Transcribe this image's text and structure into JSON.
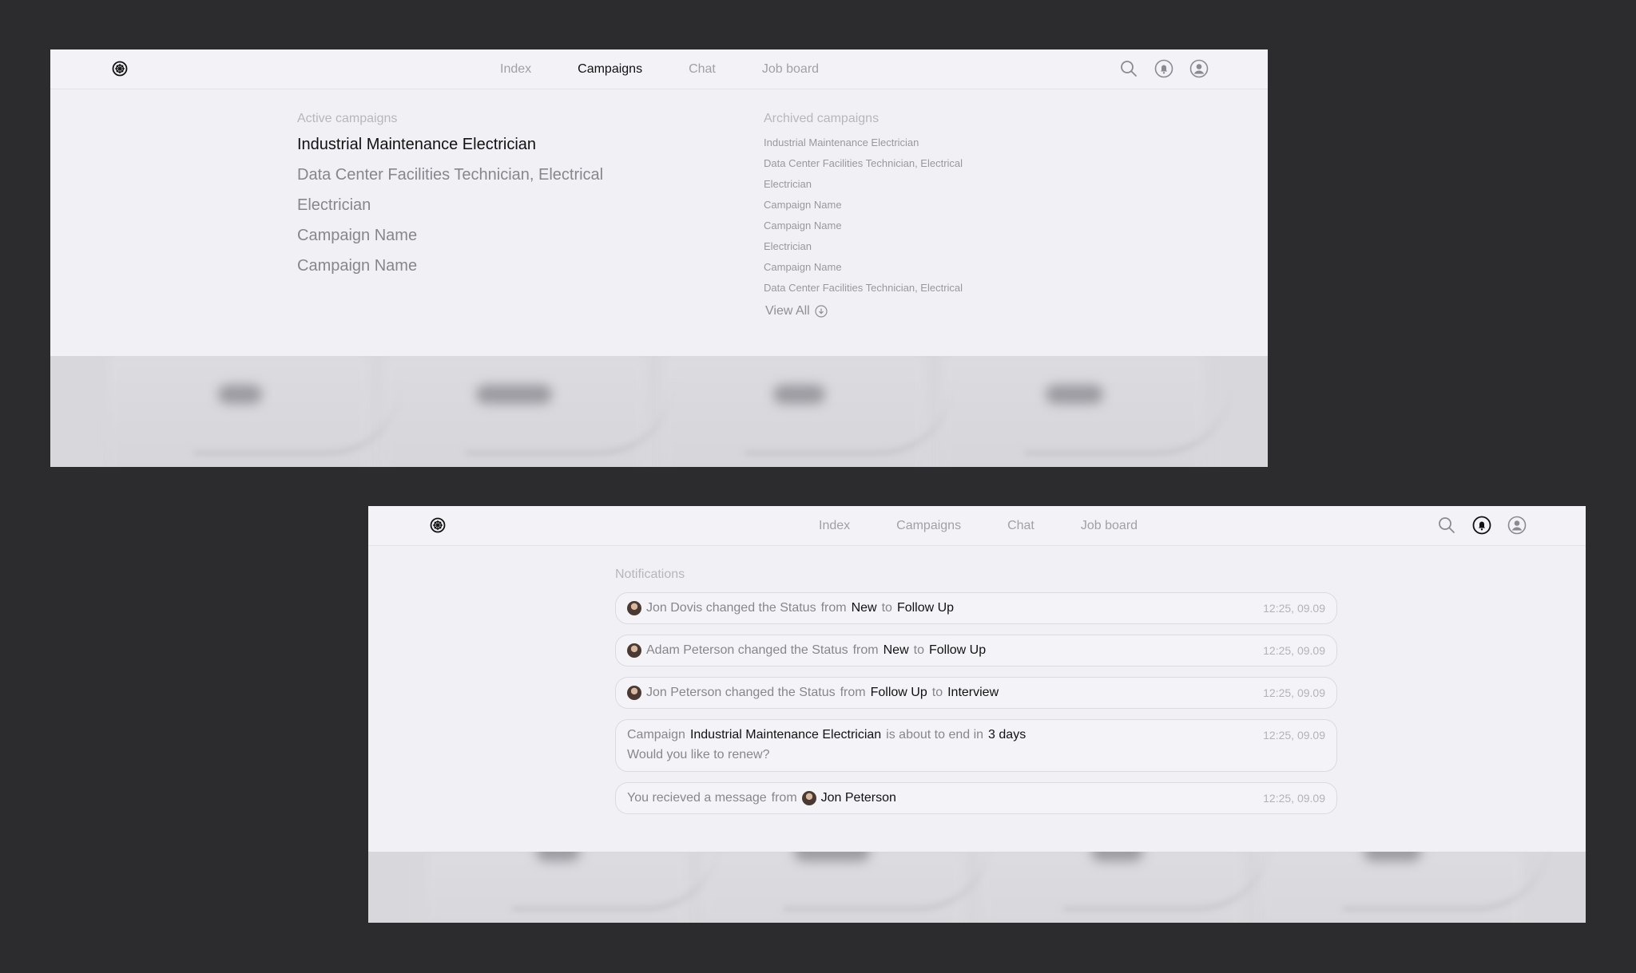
{
  "nav": {
    "items": [
      "Index",
      "Campaigns",
      "Chat",
      "Job board"
    ]
  },
  "panel1": {
    "active_nav": "Campaigns",
    "active_title": "Active campaigns",
    "active": [
      "Industrial Maintenance Electrician",
      "Data Center Facilities Technician, Electrical",
      "Electrician",
      "Campaign Name",
      "Campaign Name"
    ],
    "archived_title": "Archived campaigns",
    "archived": [
      "Industrial Maintenance Electrician",
      "Data Center Facilities Technician, Electrical",
      "Electrician",
      "Campaign Name",
      "Campaign Name",
      "Electrician",
      "Campaign Name",
      "Data Center Facilities Technician, Electrical"
    ],
    "view_all": "View All"
  },
  "panel2": {
    "title": "Notifications",
    "n1": {
      "who": "Jon Dovis changed the Status",
      "from": "from",
      "old": "New",
      "to": "to",
      "new": "Follow Up",
      "time": "12:25, 09.09"
    },
    "n2": {
      "who": "Adam Peterson changed the Status",
      "from": "from",
      "old": "New",
      "to": "to",
      "new": "Follow Up",
      "time": "12:25, 09.09"
    },
    "n3": {
      "who": "Jon Peterson changed the Status",
      "from": "from",
      "old": "Follow Up",
      "to": "to",
      "new": "Interview",
      "time": "12:25, 09.09"
    },
    "n4": {
      "pre": "Campaign",
      "campaign": "Industrial Maintenance Electrician",
      "mid": "is about to end in",
      "days": "3 days",
      "line2": "Would you like to renew?",
      "time": "12:25, 09.09"
    },
    "n5": {
      "pre": "You recieved a message",
      "from": "from",
      "name": "Jon Peterson",
      "time": "12:25, 09.09"
    }
  },
  "colors": {
    "background": "#2c2c2e",
    "panel": "#f1f1f5",
    "text_strong": "#111111",
    "text_muted": "#86868c"
  },
  "icons": [
    "logo-icon",
    "search-icon",
    "bell-icon",
    "user-icon",
    "arrow-down-circle-icon"
  ]
}
